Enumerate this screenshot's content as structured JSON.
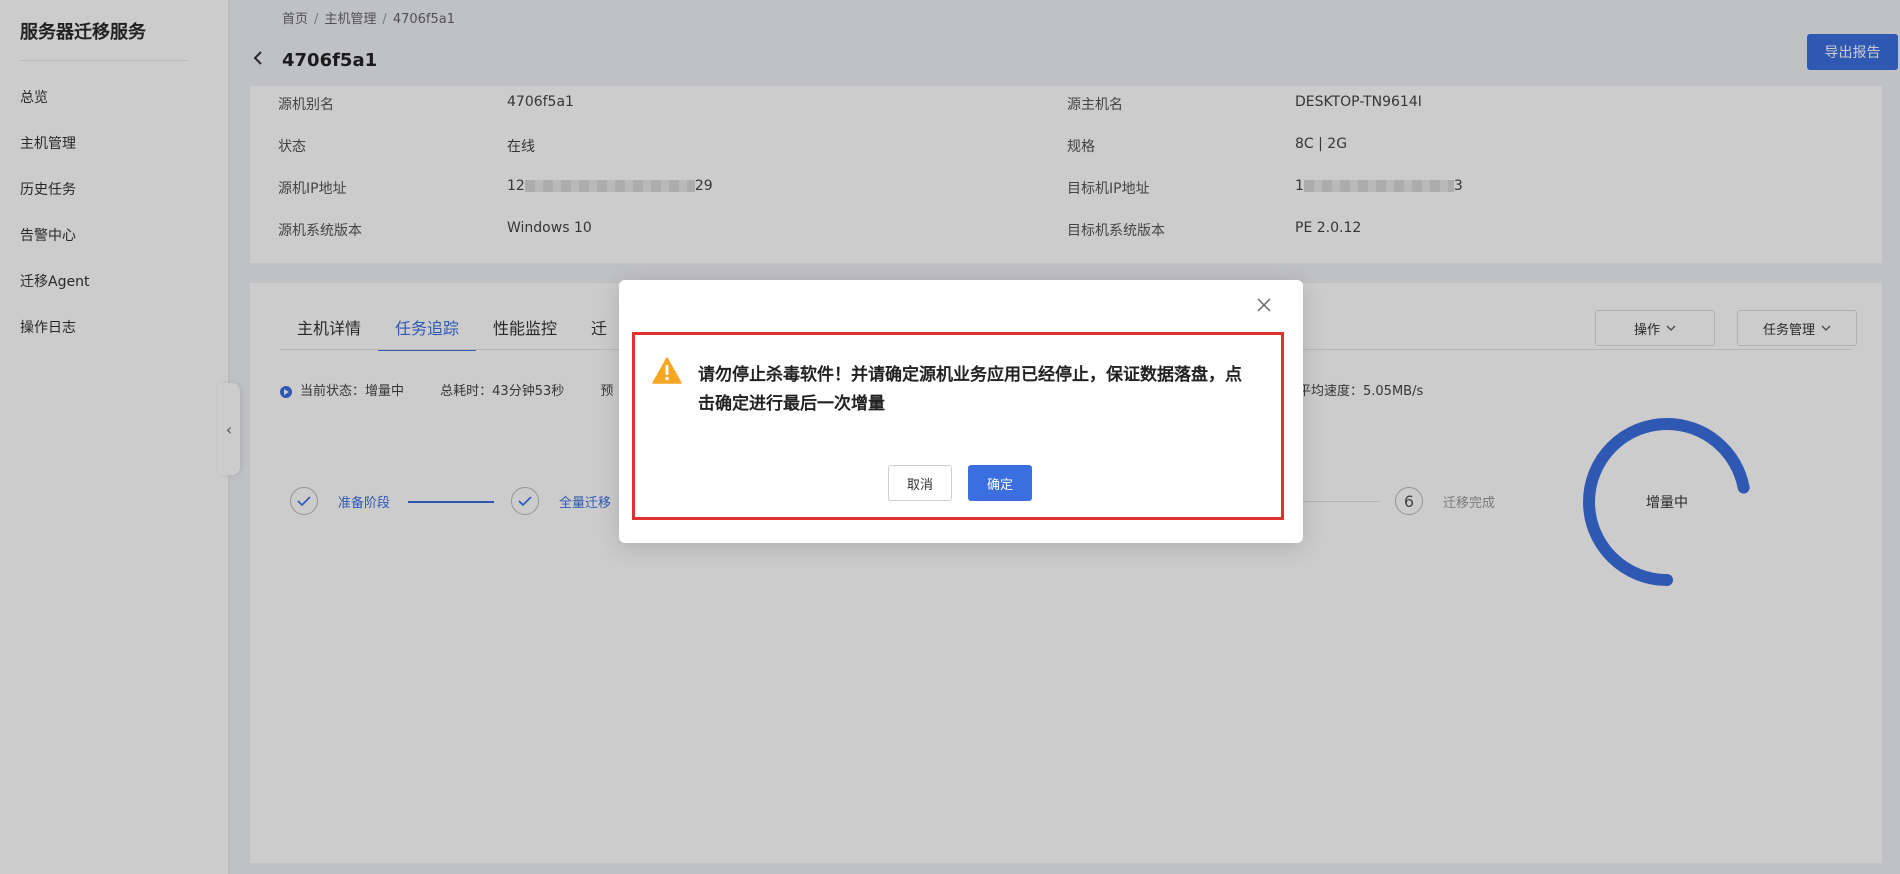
{
  "sidebar": {
    "brand": "服务器迁移服务",
    "items": [
      {
        "label": "总览"
      },
      {
        "label": "主机管理"
      },
      {
        "label": "历史任务"
      },
      {
        "label": "告警中心"
      },
      {
        "label": "迁移Agent"
      },
      {
        "label": "操作日志"
      }
    ],
    "collapse_icon": "‹"
  },
  "header": {
    "breadcrumb": [
      "首页",
      "主机管理",
      "4706f5a1"
    ],
    "title": "4706f5a1",
    "export_label": "导出报告"
  },
  "info": {
    "source_alias_label": "源机别名",
    "source_alias": "4706f5a1",
    "source_host_label": "源主机名",
    "source_host": "DESKTOP-TN9614I",
    "status_label": "状态",
    "status": "在线",
    "spec_label": "规格",
    "spec": "8C | 2G",
    "source_ip_label": "源机IP地址",
    "source_ip_prefix": "12",
    "source_ip_suffix": "29",
    "target_ip_label": "目标机IP地址",
    "target_ip_prefix": "1",
    "target_ip_suffix": "3",
    "source_os_label": "源机系统版本",
    "source_os": "Windows 10",
    "target_os_label": "目标机系统版本",
    "target_os": "PE 2.0.12"
  },
  "tabs": [
    {
      "label": "主机详情",
      "active": false
    },
    {
      "label": "任务追踪",
      "active": true
    },
    {
      "label": "性能监控",
      "active": false
    },
    {
      "label": "迁",
      "active": false
    }
  ],
  "actions": {
    "operate_label": "操作",
    "task_mgmt_label": "任务管理"
  },
  "status_bar": {
    "current_state": "当前状态：增量中",
    "total_time": "总耗时：43分钟53秒",
    "estimate_prefix": "预",
    "avg_speed": "平均速度：5.05MB/s"
  },
  "steps": [
    {
      "label": "准备阶段",
      "state": "done"
    },
    {
      "label": "全量迁移",
      "state": "done"
    },
    {
      "number": "6",
      "label": "迁移完成",
      "state": "todo"
    }
  ],
  "ring": {
    "label": "增量中",
    "progress_fraction": 0.72,
    "color": "#3b6fe0"
  },
  "modal": {
    "message": "请勿停止杀毒软件！并请确定源机业务应用已经停止，保证数据落盘，点击确定进行最后一次增量",
    "cancel_label": "取消",
    "ok_label": "确定",
    "icons": [
      "close-icon",
      "warning-icon"
    ]
  },
  "colors": {
    "accent": "#3b6fe0",
    "highlight": "#e03131",
    "warning": "#f5a623"
  }
}
